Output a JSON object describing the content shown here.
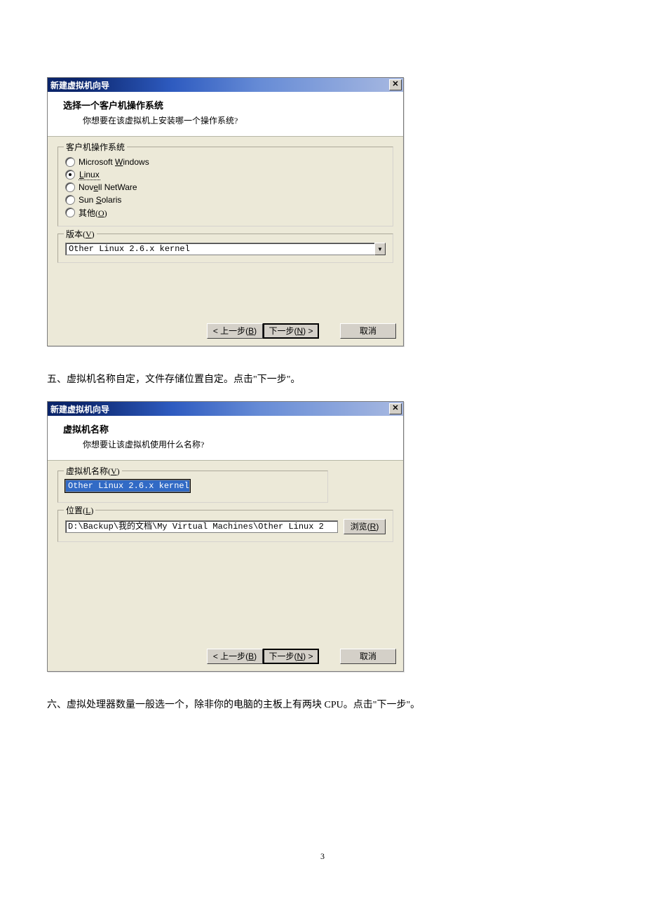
{
  "page_number": "3",
  "dialog1": {
    "title": "新建虚拟机向导",
    "header_title": "选择一个客户机操作系统",
    "header_sub": "你想要在该虚拟机上安装哪一个操作系统?",
    "group_os_legend": "客户机操作系统",
    "os_options": [
      {
        "label_pre": "Microsoft ",
        "hotkey": "W",
        "label_post": "indows",
        "checked": false
      },
      {
        "label_pre": "",
        "hotkey": "L",
        "label_post": "inux",
        "checked": true,
        "dotted": true
      },
      {
        "label_pre": "Nov",
        "hotkey": "e",
        "label_post": "ll NetWare",
        "checked": false
      },
      {
        "label_pre": "Sun ",
        "hotkey": "S",
        "label_post": "olaris",
        "checked": false
      },
      {
        "label_pre": "其他(",
        "hotkey": "O",
        "label_post": ")",
        "checked": false,
        "cjk": true
      }
    ],
    "group_ver_legend": "版本(V)",
    "version_value": "Other Linux 2.6.x kernel",
    "btn_back": "< 上一步(B)",
    "btn_next": "下一步(N) >",
    "btn_cancel": "取消"
  },
  "caption5": "五、虚拟机名称自定，文件存储位置自定。点击\"下一步\"。",
  "dialog2": {
    "title": "新建虚拟机向导",
    "header_title": "虚拟机名称",
    "header_sub": "你想要让该虚拟机使用什么名称?",
    "group_name_legend": "虚拟机名称(V)",
    "name_value": "Other Linux 2.6.x kernel",
    "group_loc_legend": "位置(L)",
    "loc_value": "D:\\Backup\\我的文档\\My Virtual Machines\\Other Linux 2",
    "btn_browse": "浏览(R)",
    "btn_back": "< 上一步(B)",
    "btn_next": "下一步(N) >",
    "btn_cancel": "取消"
  },
  "caption6": "六、虚拟处理器数量一般选一个，除非你的电脑的主板上有两块 CPU。点击\"下一步\"。"
}
